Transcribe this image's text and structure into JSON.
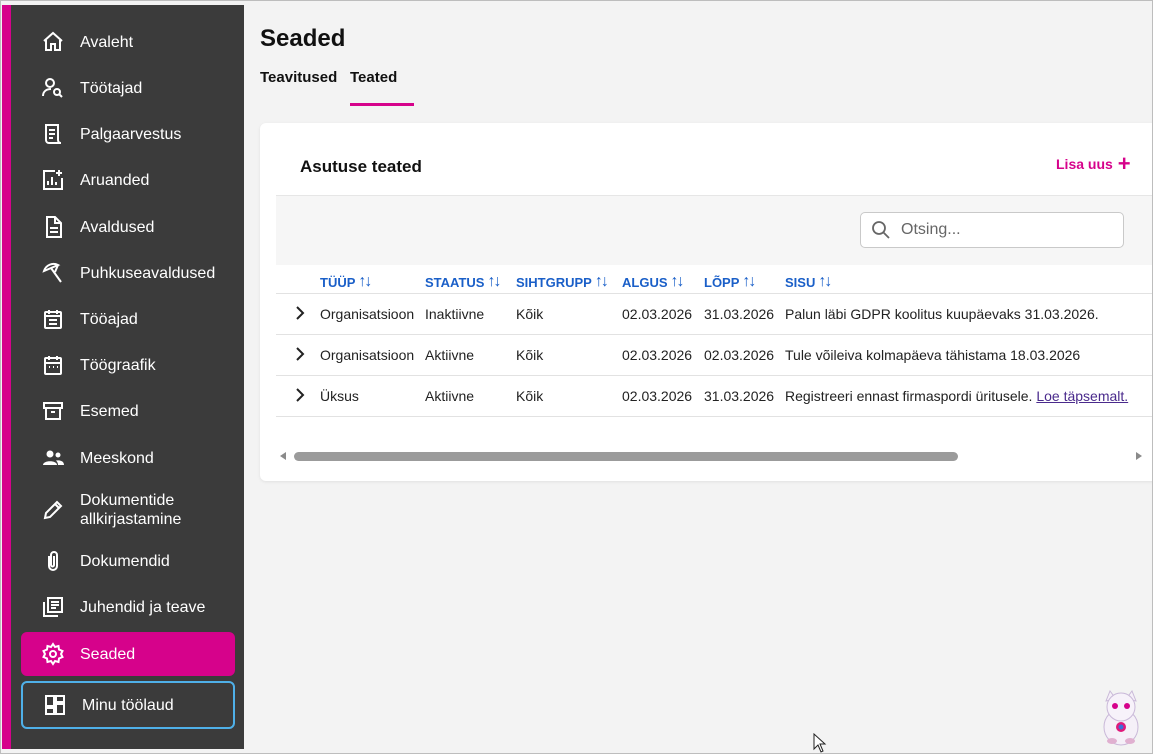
{
  "colors": {
    "accent": "#d6028b",
    "sidebar_bg": "#3b3b3b",
    "header_link": "#1a5fc8",
    "focus_outline": "#4fb0e8"
  },
  "sidebar": {
    "items": [
      {
        "label": "Avaleht",
        "icon": "home-icon"
      },
      {
        "label": "Töötajad",
        "icon": "person-search-icon"
      },
      {
        "label": "Palgaarvestus",
        "icon": "receipt-icon"
      },
      {
        "label": "Aruanded",
        "icon": "report-chart-icon"
      },
      {
        "label": "Avaldused",
        "icon": "document-icon"
      },
      {
        "label": "Puhkuseavaldused",
        "icon": "beach-icon"
      },
      {
        "label": "Tööajad",
        "icon": "calendar-list-icon"
      },
      {
        "label": "Töögraafik",
        "icon": "calendar-icon"
      },
      {
        "label": "Esemed",
        "icon": "archive-box-icon"
      },
      {
        "label": "Meeskond",
        "icon": "group-icon"
      },
      {
        "label": "Dokumentide allkirjastamine",
        "label_line1": "Dokumentide",
        "label_line2": "allkirjastamine",
        "icon": "pencil-icon"
      },
      {
        "label": "Dokumendid",
        "icon": "paperclip-icon"
      },
      {
        "label": "Juhendid ja teave",
        "icon": "library-books-icon"
      },
      {
        "label": "Seaded",
        "icon": "gear-icon",
        "active": true
      },
      {
        "label": "Minu töölaud",
        "icon": "dashboard-icon"
      }
    ]
  },
  "page": {
    "title": "Seaded",
    "tabs": [
      {
        "label": "Teavitused",
        "active": false
      },
      {
        "label": "Teated",
        "active": true
      }
    ]
  },
  "card": {
    "title": "Asutuse teated",
    "add_label": "Lisa uus",
    "add_icon": "plus-icon",
    "search_placeholder": "Otsing...",
    "columns": [
      "TÜÜP",
      "STAATUS",
      "SIHTGRUPP",
      "ALGUS",
      "LÕPP",
      "SISU"
    ],
    "rows": [
      {
        "type": "Organisatsioon",
        "status": "Inaktiivne",
        "target": "Kõik",
        "start": "02.03.2026",
        "end": "31.03.2026",
        "content": "Palun läbi GDPR koolitus kuupäevaks 31.03.2026."
      },
      {
        "type": "Organisatsioon",
        "status": "Aktiivne",
        "target": "Kõik",
        "start": "02.03.2026",
        "end": "02.03.2026",
        "content": "Tule võileiva kolmapäeva tähistama 18.03.2026"
      },
      {
        "type": "Üksus",
        "status": "Aktiivne",
        "target": "Kõik",
        "start": "02.03.2026",
        "end": "31.03.2026",
        "content": "Registreeri ennast firmaspordi üritusele.",
        "link": "Loe täpsemalt."
      }
    ]
  }
}
